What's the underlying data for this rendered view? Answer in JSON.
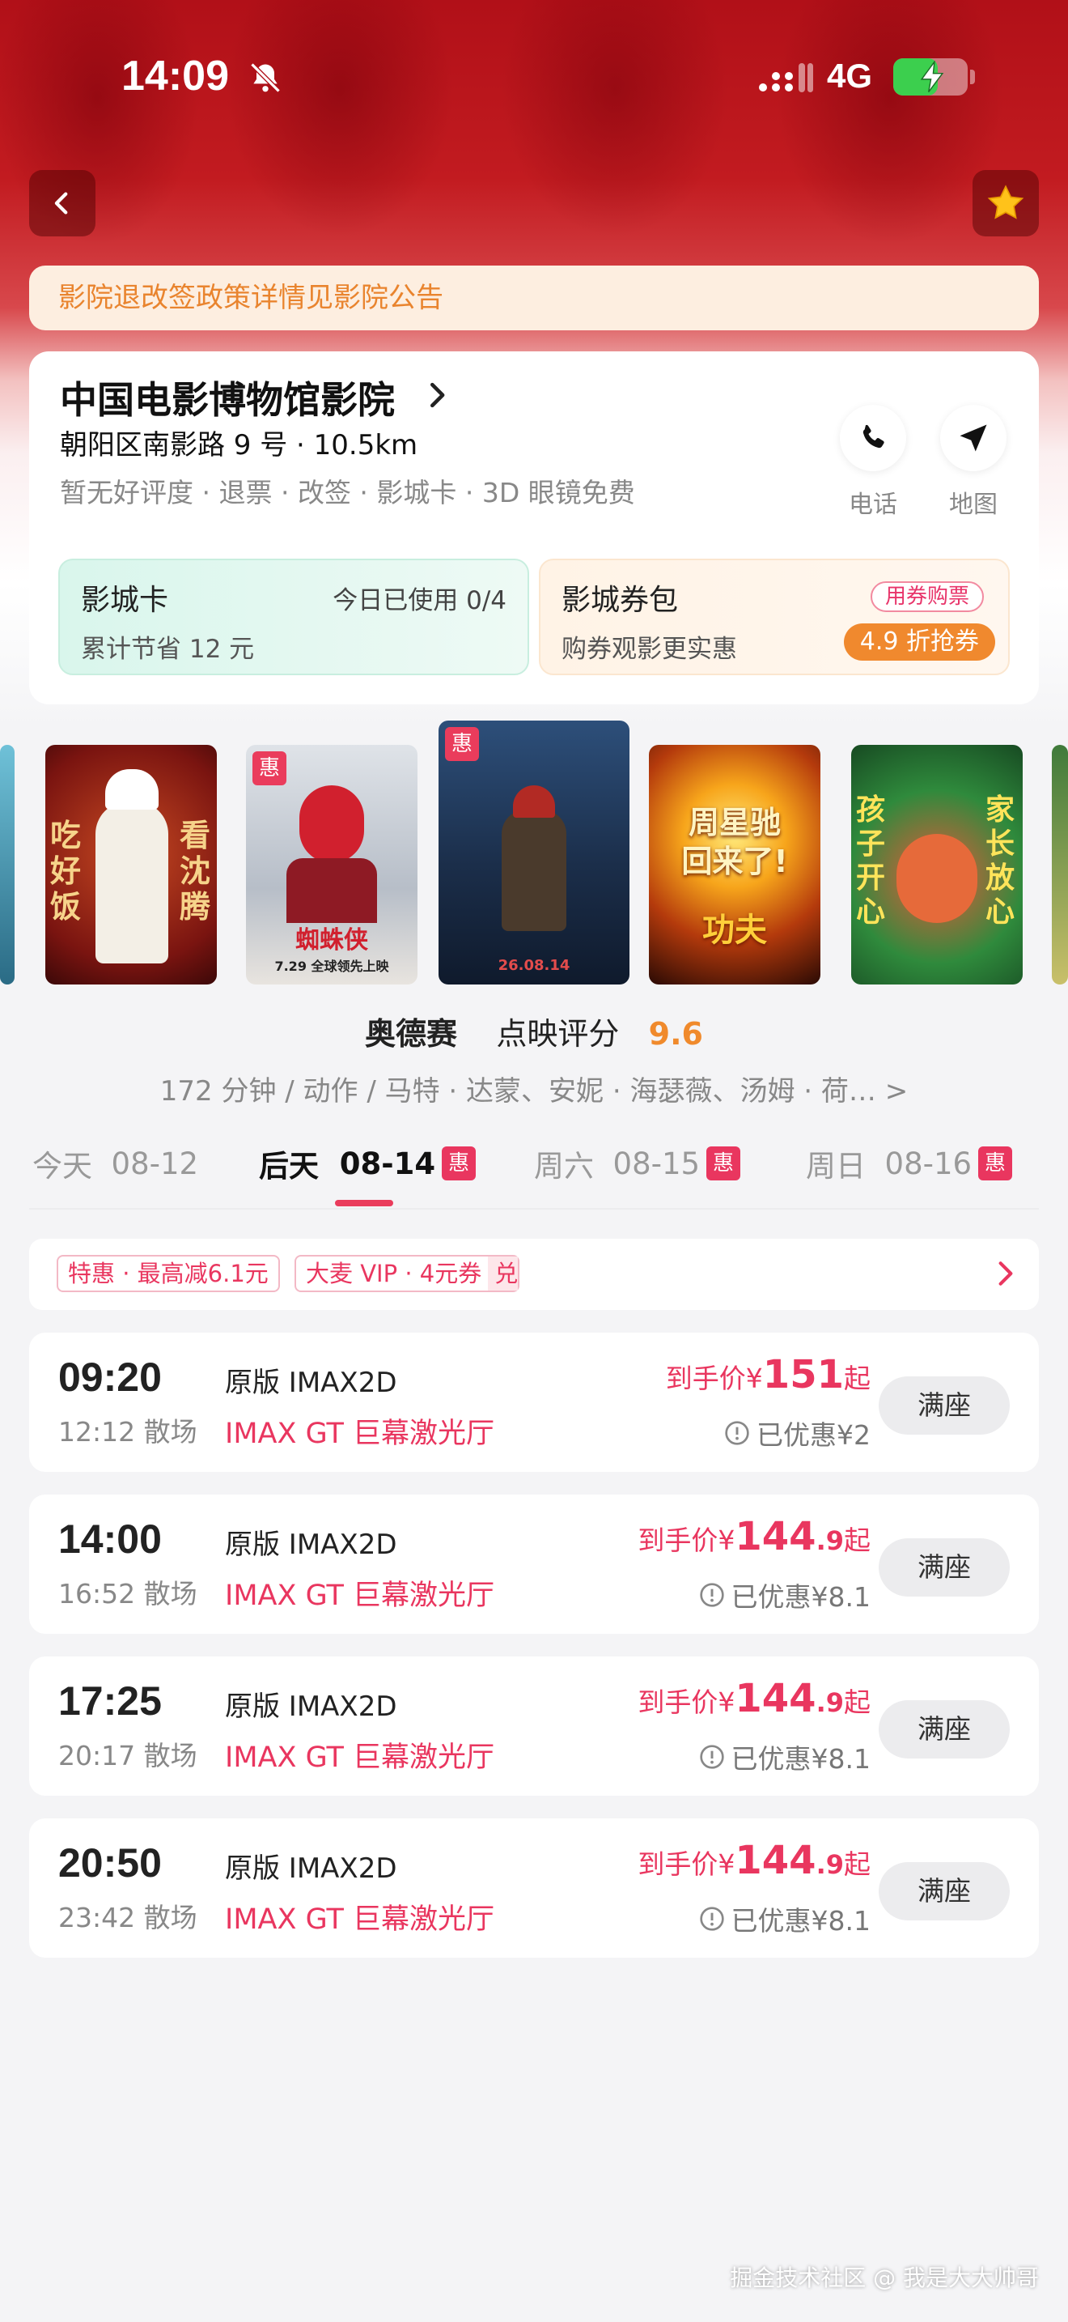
{
  "status_bar": {
    "time": "14:09",
    "network": "4G",
    "battery_level": 0.6,
    "battery_color": "#3ccf4e"
  },
  "notice": "影院退改签政策详情见影院公告",
  "cinema": {
    "name": "中国电影博物馆影院",
    "address": "朝阳区南影路 9 号 · 10.5km",
    "tags": "暂无好评度 · 退票 · 改签 · 影城卡 · 3D 眼镜免费",
    "phone_label": "电话",
    "map_label": "地图",
    "card": {
      "title": "影城卡",
      "usage": "今日已使用 0/4",
      "saved": "累计节省 12 元"
    },
    "coupon": {
      "title": "影城券包",
      "subtitle": "购券观影更实惠",
      "tag": "用券购票",
      "discount": "4.9 折抢券"
    }
  },
  "posters": [
    {
      "name": "poster-partial-left",
      "badge": ""
    },
    {
      "name": "poster-chiyaofan",
      "badge": "",
      "text_left": "吃好饭",
      "text_right": "看沈腾"
    },
    {
      "name": "poster-spiderman",
      "badge": "惠",
      "text_main": "蜘蛛侠",
      "text_date": "7.29 全球领先上映"
    },
    {
      "name": "poster-odyssey",
      "badge": "惠",
      "text_date": "26.08.14"
    },
    {
      "name": "poster-kungfu",
      "badge": "",
      "text_main": "周星驰\n回来了!",
      "text_sub": "功夫"
    },
    {
      "name": "poster-pawpatrol",
      "badge": "",
      "text_left": "孩子开心",
      "text_right": "家长放心"
    },
    {
      "name": "poster-partial-right",
      "badge": ""
    }
  ],
  "movie": {
    "title": "奥德赛",
    "score_label": "点映评分",
    "score": "9.6",
    "meta": "172 分钟 / 动作 / 马特 · 达蒙、安妮 · 海瑟薇、汤姆 · 荷… >"
  },
  "date_tabs": [
    {
      "label": "今天",
      "date": "08-12",
      "badge": "",
      "active": false
    },
    {
      "label": "后天",
      "date": "08-14",
      "badge": "惠",
      "active": true
    },
    {
      "label": "周六",
      "date": "08-15",
      "badge": "惠",
      "active": false
    },
    {
      "label": "周日",
      "date": "08-16",
      "badge": "惠",
      "active": false
    }
  ],
  "promo": {
    "tag1": "特惠 · 最高减6.1元",
    "tag2": "大麦 VIP · 4元券",
    "tag2_swap": "兑"
  },
  "showtimes": [
    {
      "start": "09:20",
      "end": "12:12 散场",
      "version": "原版 IMAX2D",
      "hall": "IMAX GT 巨幕激光厅",
      "price_prefix": "到手价¥",
      "price_int": "151",
      "price_dec": "",
      "price_suffix": "起",
      "saved": "已优惠¥2",
      "button": "满座"
    },
    {
      "start": "14:00",
      "end": "16:52 散场",
      "version": "原版 IMAX2D",
      "hall": "IMAX GT 巨幕激光厅",
      "price_prefix": "到手价¥",
      "price_int": "144",
      "price_dec": ".9",
      "price_suffix": "起",
      "saved": "已优惠¥8.1",
      "button": "满座"
    },
    {
      "start": "17:25",
      "end": "20:17 散场",
      "version": "原版 IMAX2D",
      "hall": "IMAX GT 巨幕激光厅",
      "price_prefix": "到手价¥",
      "price_int": "144",
      "price_dec": ".9",
      "price_suffix": "起",
      "saved": "已优惠¥8.1",
      "button": "满座"
    },
    {
      "start": "20:50",
      "end": "23:42 散场",
      "version": "原版 IMAX2D",
      "hall": "IMAX GT 巨幕激光厅",
      "price_prefix": "到手价¥",
      "price_int": "144",
      "price_dec": ".9",
      "price_suffix": "起",
      "saved": "已优惠¥8.1",
      "button": "满座"
    }
  ],
  "watermark": "掘金技术社区 @ 我是大大帅哥",
  "colors": {
    "accent": "#e9365f",
    "orange": "#f0892e",
    "header_red": "#c21b20"
  }
}
